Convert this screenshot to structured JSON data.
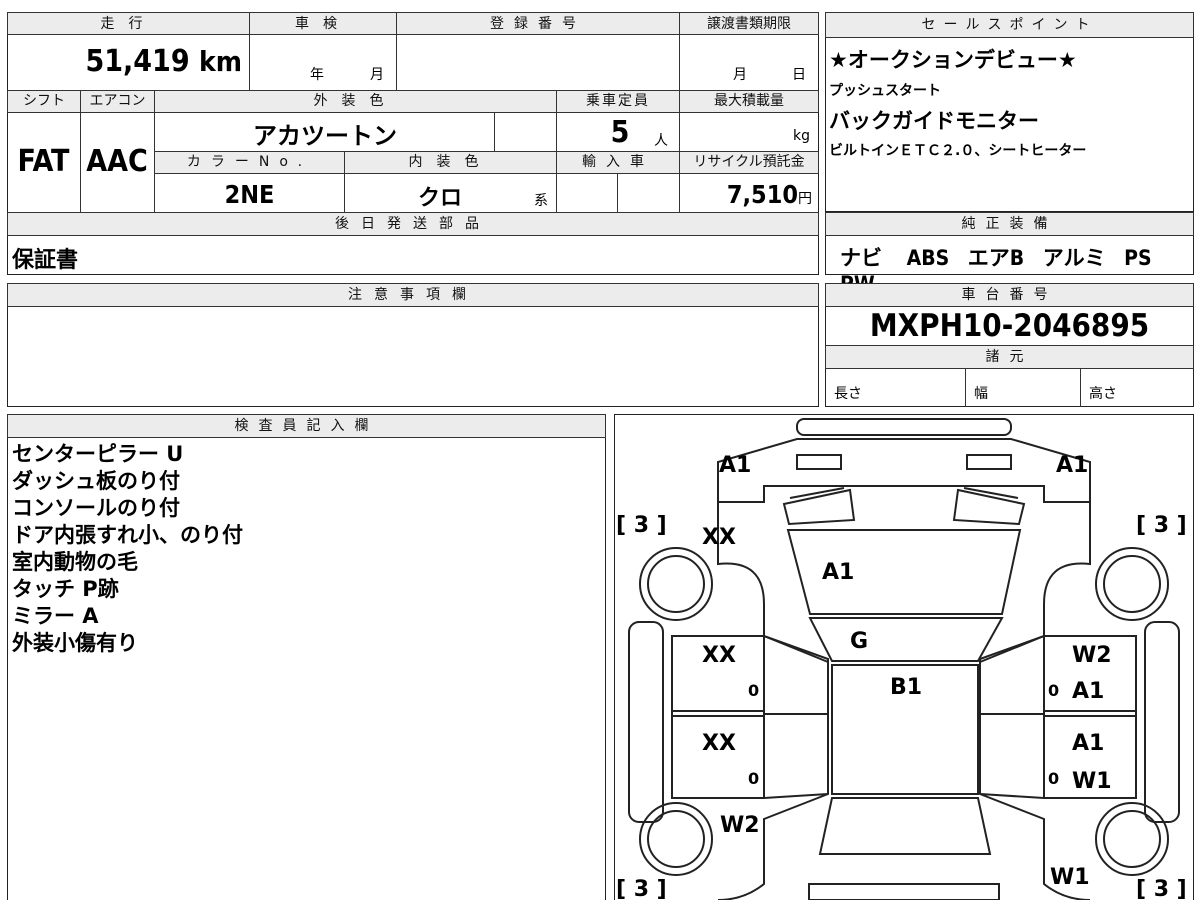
{
  "top_section": {
    "mileage": {
      "header": "走行",
      "value": "51,419",
      "unit": "km"
    },
    "shaken": {
      "header": "車検",
      "year_label": "年",
      "month_label": "月"
    },
    "registration": {
      "header": "登録番号",
      "value": ""
    },
    "transfer_deadline": {
      "header": "譲渡書類期限",
      "month_label": "月",
      "day_label": "日"
    },
    "shift": {
      "header": "シフト",
      "value": "FAT"
    },
    "aircon": {
      "header": "エアコン",
      "value": "AAC"
    },
    "exterior_color": {
      "header": "外装色",
      "value": "アカツートン"
    },
    "capacity": {
      "header": "乗車定員",
      "value": "5",
      "unit": "人"
    },
    "max_load": {
      "header": "最大積載量",
      "value": "",
      "unit": "kg"
    },
    "color_no": {
      "header": "カラーNo.",
      "value": "2NE"
    },
    "interior_color": {
      "header": "内装色",
      "value": "クロ",
      "suffix": "系"
    },
    "import": {
      "header": "輸入車",
      "value": ""
    },
    "recycle": {
      "header": "リサイクル預託金",
      "value": "7,510",
      "unit": "円"
    },
    "later_parts": {
      "header": "後日発送部品",
      "value": "保証書"
    }
  },
  "sales_points": {
    "header": "セールスポイント",
    "lines": [
      "★オークションデビュー★",
      "プッシュスタート",
      "バックガイドモニター",
      "ビルトインＥＴＣ２.０、シートヒーター"
    ]
  },
  "genuine_equipment": {
    "header": "純正装備",
    "items": [
      "ナビ",
      "ABS",
      "エアB",
      "アルミ",
      "PS",
      "PW"
    ]
  },
  "notes": {
    "header": "注意事項欄",
    "value": ""
  },
  "chassis": {
    "header": "車台番号",
    "value": "MXPH10-2046895"
  },
  "specs": {
    "header": "諸元",
    "length": "長さ",
    "width": "幅",
    "height": "高さ"
  },
  "inspector": {
    "header": "検査員記入欄",
    "lines": [
      "センターピラー U",
      "ダッシュ板のり付",
      "コンソールのり付",
      "ドア内張すれ小、のり付",
      "室内動物の毛",
      "タッチ P跡",
      "ミラー A",
      "外装小傷有り"
    ]
  },
  "damage_map": {
    "tire_fl": "[ 3 ]",
    "tire_fr": "[ 3 ]",
    "tire_rl": "[ 3 ]",
    "tire_rr": "[ 3 ]",
    "bumper_left": "A1",
    "bumper_right": "A1",
    "left_fender": "XX",
    "hood": "A1",
    "windshield": "G",
    "roof": "B1",
    "left_front_door": "XX",
    "left_front_door_small": "0",
    "left_rear_door": "XX",
    "left_rear_door_small": "0",
    "left_rear_quarter": "W2",
    "right_front_door_1": "W2",
    "right_front_door_2": "A1",
    "right_front_door_small": "0",
    "right_rear_door_1": "A1",
    "right_rear_door_2": "W1",
    "right_rear_door_small": "0",
    "right_rear_quarter": "W1"
  }
}
